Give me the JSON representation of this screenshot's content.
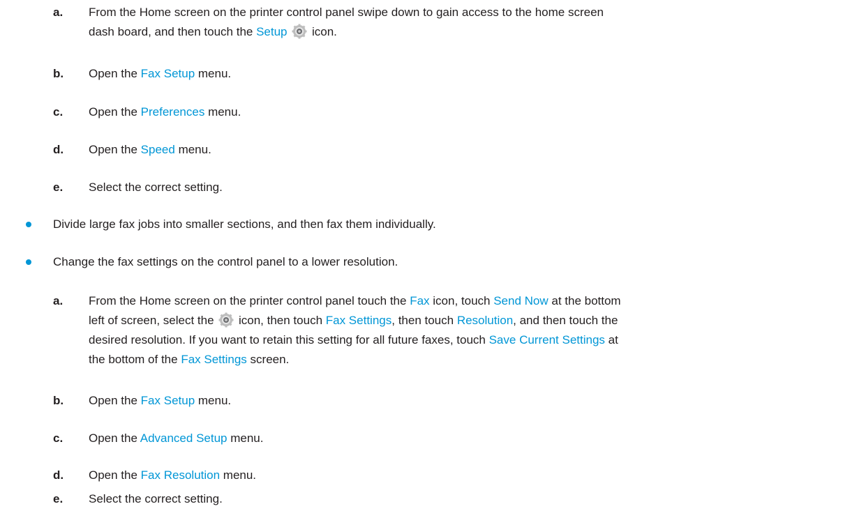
{
  "step_a1": {
    "letter": "a.",
    "t1": "From the Home screen on the printer control panel swipe down to gain access to the home screen",
    "t2": "dash board, and then touch the ",
    "link_setup": "Setup",
    "t3": " icon."
  },
  "step_b1": {
    "letter": "b.",
    "pre": "Open the ",
    "link": "Fax Setup",
    "post": " menu."
  },
  "step_c1": {
    "letter": "c.",
    "pre": "Open the ",
    "link": "Preferences",
    "post": " menu."
  },
  "step_d1": {
    "letter": "d.",
    "pre": "Open the ",
    "link": "Speed",
    "post": " menu."
  },
  "step_e1": {
    "letter": "e.",
    "text": "Select the correct setting."
  },
  "bullet1": "Divide large fax jobs into smaller sections, and then fax them individually.",
  "bullet2": "Change the fax settings on the control panel to a lower resolution.",
  "step_a2": {
    "letter": "a.",
    "l1_pre": "From the Home screen on the printer control panel touch the ",
    "l1_fax": "Fax",
    "l1_mid": " icon, touch ",
    "l1_send": "Send Now",
    "l1_post": " at the bottom",
    "l2_pre": "left of screen, select the ",
    "l2_mid": " icon, then touch ",
    "l2_faxset": "Fax Settings",
    "l2_mid2": ", then touch ",
    "l2_res": "Resolution",
    "l2_post": ", and then touch the",
    "l3_pre": "desired resolution. If you want to retain this setting for all future faxes, touch ",
    "l3_save": "Save Current Settings",
    "l3_post": " at",
    "l4_pre": "the bottom of the ",
    "l4_faxset": "Fax Settings",
    "l4_post": " screen."
  },
  "step_b2": {
    "letter": "b.",
    "pre": "Open the ",
    "link": "Fax Setup",
    "post": " menu."
  },
  "step_c2": {
    "letter": "c.",
    "pre": "Open the ",
    "link": "Advanced Setup",
    "post": " menu."
  },
  "step_d2": {
    "letter": "d.",
    "pre": "Open the ",
    "link": "Fax Resolution",
    "post": " menu."
  },
  "step_e2": {
    "letter": "e.",
    "text": "Select the correct setting."
  },
  "colors": {
    "link": "#0096d6",
    "text": "#231f20",
    "bullet": "#0096d6"
  },
  "icons": {
    "setup": "gear-icon"
  }
}
